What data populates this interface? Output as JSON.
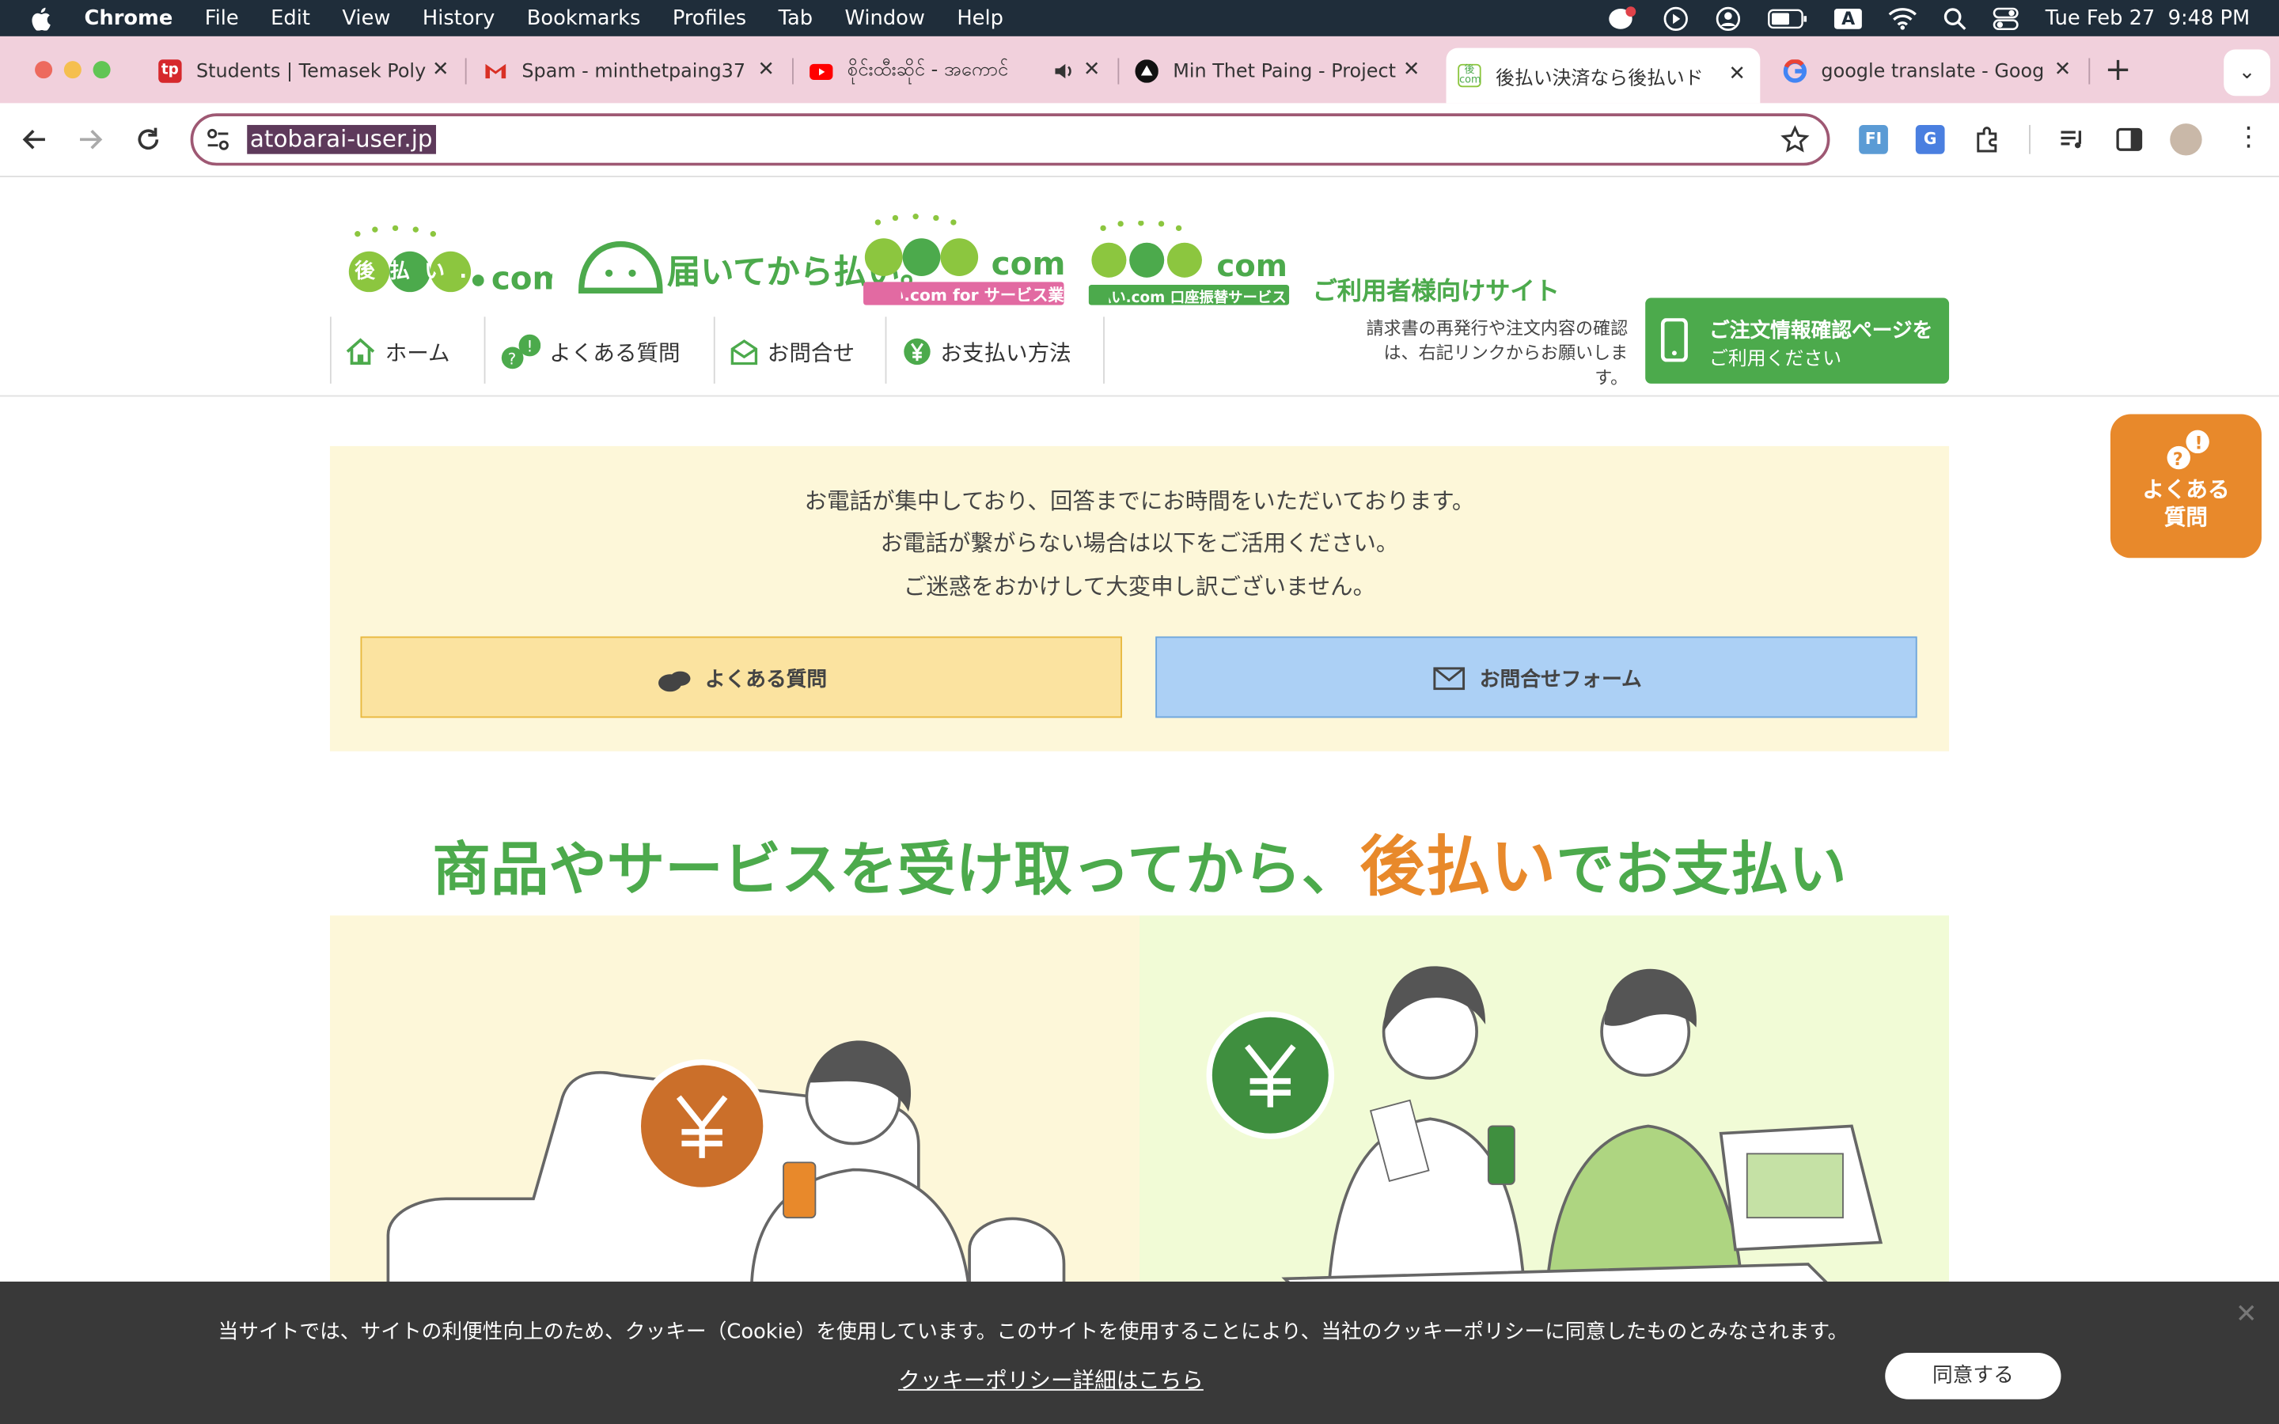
{
  "menubar": {
    "app": "Chrome",
    "items": [
      "File",
      "Edit",
      "View",
      "History",
      "Bookmarks",
      "Profiles",
      "Tab",
      "Window",
      "Help"
    ],
    "clock": "Tue Feb 27  9:48 PM",
    "input_indicator": "A"
  },
  "tabs": [
    {
      "title": "Students | Temasek Poly",
      "favicon": "tp-icon"
    },
    {
      "title": "Spam - minthetpaing37",
      "favicon": "gmail-icon"
    },
    {
      "title": "စိုင်းထီးဆိုင် - အကောင်",
      "favicon": "youtube-icon"
    },
    {
      "title": "Min Thet Paing - Project",
      "favicon": "triangle-icon"
    },
    {
      "title": "後払い決済なら後払いド",
      "favicon": "atobarai-icon"
    },
    {
      "title": "google translate - Goog",
      "favicon": "google-icon"
    }
  ],
  "toolbar": {
    "url": "atobarai-user.jp"
  },
  "site": {
    "label": "ご利用者様向けサイト",
    "logos": [
      "後払い.com",
      "届いてから払い。",
      "後払い.com for サービス業",
      "後払い.com 口座振替サービス"
    ],
    "nav": [
      "ホーム",
      "よくある質問",
      "お問合せ",
      "お支払い方法"
    ],
    "help_note_1": "請求書の再発行や注文内容の確認",
    "help_note_2": "は、右記リンクからお願いします。",
    "order_button_1": "ご注文情報確認ページを",
    "order_button_2": "ご利用ください"
  },
  "notice": {
    "line1": "お電話が集中しており、回答までにお時間をいただいております。",
    "line2": "お電話が繋がらない場合は以下をご活用ください。",
    "line3": "ご迷惑をおかけして大変申し訳ございません。",
    "faq_button": "よくある質問",
    "contact_button": "お問合せフォーム"
  },
  "headline": {
    "part1": "商品やサービスを受け取ってから、",
    "highlight": "後払い",
    "part2": "でお支払い"
  },
  "float_faq": {
    "line1": "よくある",
    "line2": "質問"
  },
  "cookie": {
    "text": "当サイトでは、サイトの利便性向上のため、クッキー（Cookie）を使用しています。このサイトを使用することにより、当社のクッキーポリシーに同意したものとみなされます。",
    "link": "クッキーポリシー詳細はこちら",
    "agree": "同意する"
  },
  "colors": {
    "green": "#4caa4c",
    "orange": "#e8892b",
    "notice_bg": "#fdf7d9",
    "cookie_bg": "#393939"
  }
}
